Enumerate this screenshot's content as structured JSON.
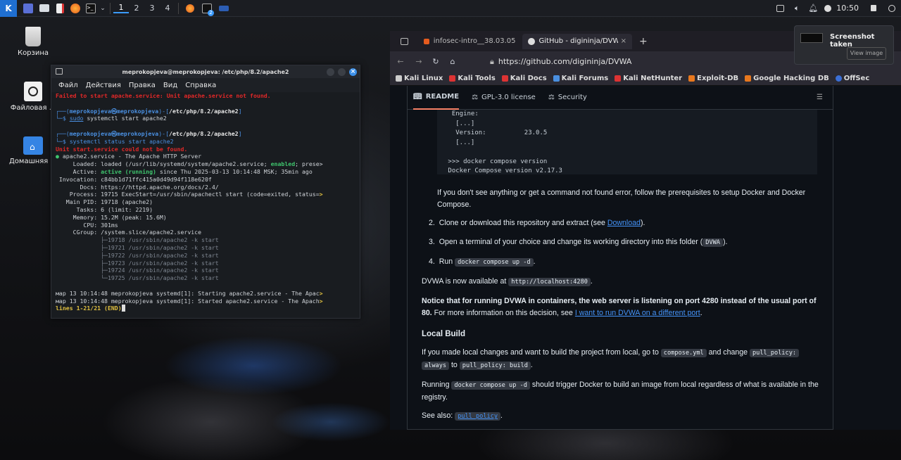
{
  "panel": {
    "workspaces": [
      "1",
      "2",
      "3",
      "4"
    ],
    "clock": "10:50",
    "badge": "2"
  },
  "desktop": {
    "icons": [
      {
        "label": "Корзина"
      },
      {
        "label": "Файловая ..."
      },
      {
        "label": "Домашняя ..."
      }
    ]
  },
  "terminal": {
    "title": "meprokopjeva@meprokopjeva: /etc/php/8.2/apache2",
    "menu": [
      "Файл",
      "Действия",
      "Правка",
      "Вид",
      "Справка"
    ],
    "lines": {
      "l0": "Failed to start apache.service: Unit apache.service not found.",
      "p1_user": "meprokopjeva㉿meprokopjeva",
      "p1_dir": "/etc/php/8.2/apache2",
      "p1_cmd_sudo": "sudo",
      "p1_cmd_rest": " systemctl start apache2",
      "p2_user": "meprokopjeva㉿meprokopjeva",
      "p2_dir": "/etc/php/8.2/apache2",
      "p2_cmd": "systemctl status start apache2",
      "err": "Unit start.service could not be found.",
      "svc": "apache2.service - The Apache HTTP Server",
      "loaded_a": "     Loaded: loaded (/usr/lib/systemd/system/apache2.service; ",
      "loaded_en": "enabled",
      "loaded_b": "; prese>",
      "active_a": "     Active: ",
      "active_b": "active (running)",
      "active_c": " since Thu 2025-03-13 10:14:48 MSK; 35min ago",
      "invocation": " Invocation: c84bb1d71ffc415a0d49d94f118e620f",
      "docs": "       Docs: https://httpd.apache.org/docs/2.4/",
      "process": "    Process: 19715 ExecStart=/usr/sbin/apachectl start (code=exited, status=",
      "process_tail": ">",
      "mainpid": "   Main PID: 19718 (apache2)",
      "tasks": "      Tasks: 6 (limit: 2219)",
      "memory": "     Memory: 15.2M (peak: 15.6M)",
      "cpu": "        CPU: 301ms",
      "cgroup": "     CGroup: /system.slice/apache2.service",
      "c1": "             ├─19718 /usr/sbin/apache2 -k start",
      "c2": "             ├─19721 /usr/sbin/apache2 -k start",
      "c3": "             ├─19722 /usr/sbin/apache2 -k start",
      "c4": "             ├─19723 /usr/sbin/apache2 -k start",
      "c5": "             ├─19724 /usr/sbin/apache2 -k start",
      "c6": "             └─19725 /usr/sbin/apache2 -k start",
      "j1": "мар 13 10:14:48 meprokopjeva systemd[1]: Starting apache2.service - The Apac",
      "j2": "мар 13 10:14:48 meprokopjeva systemd[1]: Started apache2.service - The Apach",
      "end": "lines 1-21/21 (END)"
    }
  },
  "browser": {
    "tab1": "infosec-intro__38.03.05:",
    "tab2": "GitHub - digininja/DVWA",
    "url": "https://github.com/digininja/DVWA",
    "bookmarks": [
      "Kali Linux",
      "Kali Tools",
      "Kali Docs",
      "Kali Forums",
      "Kali NetHunter",
      "Exploit-DB",
      "Google Hacking DB",
      "OffSec"
    ],
    "readme_tabs": [
      "README",
      "GPL-3.0 license",
      "Security"
    ],
    "code1": "  Engine:\n   [...]\n   Version:          23.0.5\n   [...]\n\n >>> docker compose version\n Docker Compose version v2.17.3",
    "p_prereq": "If you don't see anything or get a command not found error, follow the prerequisites to setup Docker and Docker Compose.",
    "li2_a": "Clone or download this repository and extract (see ",
    "li2_link": "Download",
    "li2_b": ").",
    "li3_a": "Open a terminal of your choice and change its working directory into this folder (",
    "li3_code": "DVWA",
    "li3_b": ").",
    "li4_a": "Run ",
    "li4_code": "docker compose up -d",
    "li4_b": ".",
    "avail_a": "DVWA is now available at ",
    "avail_code": "http://localhost:4280",
    "avail_b": ".",
    "notice_bold": "Notice that for running DVWA in containers, the web server is listening on port 4280 instead of the usual port of 80.",
    "notice_rest": " For more information on this decision, see ",
    "notice_link": "I want to run DVWA on a different port",
    "notice_end": ".",
    "h_local": "Local Build",
    "lb_a": "If you made local changes and want to build the project from local, go to ",
    "lb_code1": "compose.yml",
    "lb_b": " and change ",
    "lb_code2": "pull_policy:",
    "lb_code3": "always",
    "lb_c": " to ",
    "lb_code4": "pull_policy: build",
    "lb_d": ".",
    "run_a": "Running ",
    "run_code": "docker compose up -d",
    "run_b": " should trigger Docker to build an image from local regardless of what is available in the registry.",
    "see_a": "See also: ",
    "see_code": "pull_policy",
    "see_b": "."
  },
  "notification": {
    "title": "Screenshot taken",
    "button": "View image"
  }
}
